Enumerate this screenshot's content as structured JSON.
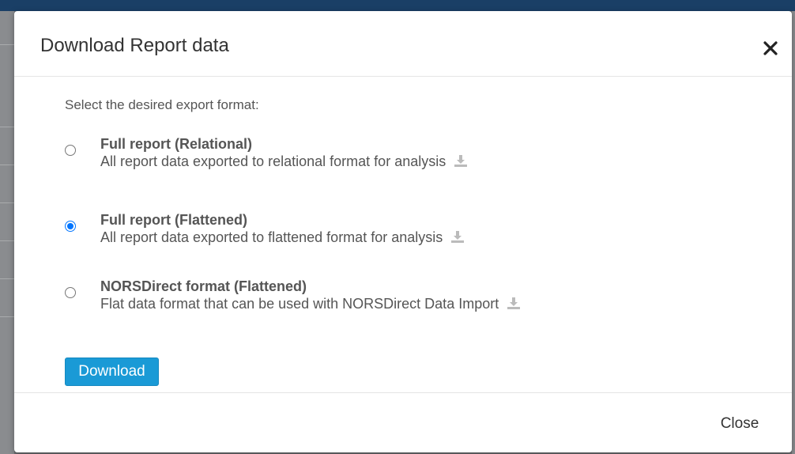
{
  "modal": {
    "title": "Download Report data",
    "prompt": "Select the desired export format:",
    "options": [
      {
        "title": "Full report (Relational)",
        "description": "All report data exported to relational format for analysis",
        "selected": false
      },
      {
        "title": "Full report (Flattened)",
        "description": "All report data exported to flattened format for analysis",
        "selected": true
      },
      {
        "title": "NORSDirect format (Flattened)",
        "description": "Flat data format that can be used with NORSDirect Data Import",
        "selected": false
      }
    ],
    "download_label": "Download",
    "close_label": "Close"
  },
  "colors": {
    "primary_button": "#1a9ad6",
    "radio_selected": "#0075ff",
    "text": "#555555",
    "icon": "#bbbbbb"
  },
  "icons": {
    "close": "close-icon",
    "download": "download-icon"
  }
}
